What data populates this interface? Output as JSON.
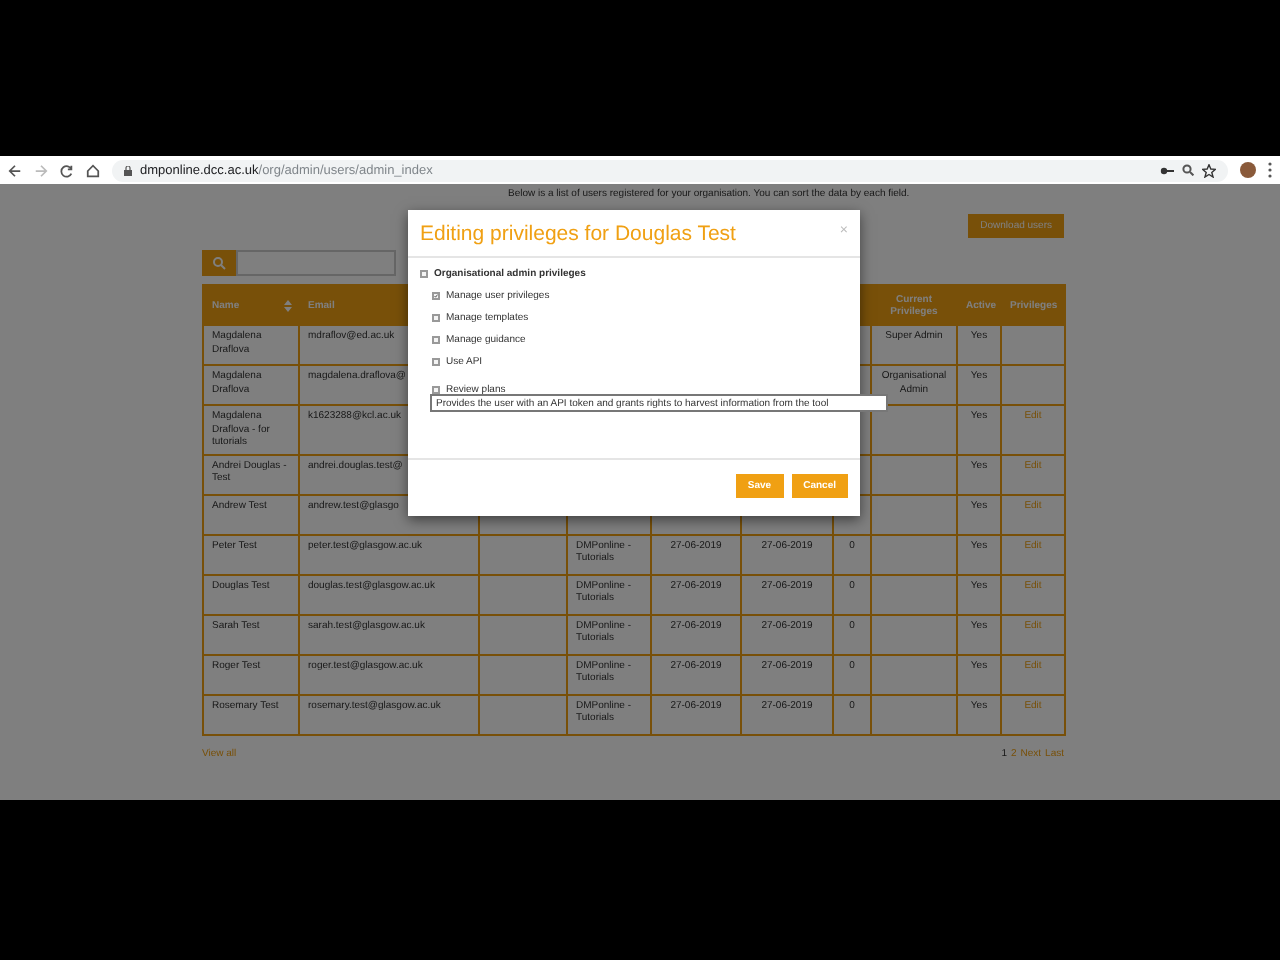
{
  "browser": {
    "url_host": "dmponline.dcc.ac.uk",
    "url_path": "/org/admin/users/admin_index"
  },
  "intro": "Below is a list of users registered for your organisation. You can sort the data by each field.",
  "download_button": "Download users",
  "table": {
    "columns": [
      "Name",
      "Email",
      null,
      null,
      null,
      null,
      null,
      "Current Privileges",
      "Active",
      "Privileges"
    ],
    "rows": [
      [
        "Magdalena Draflova",
        "mdraflov@ed.ac.uk",
        null,
        null,
        null,
        null,
        null,
        "Super Admin",
        "Yes",
        null
      ],
      [
        "Magdalena Draflova",
        "magdalena.draflova@",
        null,
        null,
        null,
        null,
        null,
        "Organisational Admin",
        "Yes",
        null
      ],
      [
        "Magdalena Draflova - for tutorials",
        "k1623288@kcl.ac.uk",
        null,
        null,
        null,
        null,
        null,
        null,
        "Yes",
        "Edit"
      ],
      [
        "Andrei Douglas - Test",
        "andrei.douglas.test@",
        null,
        null,
        null,
        null,
        null,
        null,
        "Yes",
        "Edit"
      ],
      [
        "Andrew Test",
        "andrew.test@glasgo",
        null,
        null,
        null,
        null,
        null,
        null,
        "Yes",
        "Edit"
      ],
      [
        "Peter Test",
        "peter.test@glasgow.ac.uk",
        null,
        "DMPonline - Tutorials",
        "27-06-2019",
        "27-06-2019",
        "0",
        null,
        "Yes",
        "Edit"
      ],
      [
        "Douglas Test",
        "douglas.test@glasgow.ac.uk",
        null,
        "DMPonline - Tutorials",
        "27-06-2019",
        "27-06-2019",
        "0",
        null,
        "Yes",
        "Edit"
      ],
      [
        "Sarah Test",
        "sarah.test@glasgow.ac.uk",
        null,
        "DMPonline - Tutorials",
        "27-06-2019",
        "27-06-2019",
        "0",
        null,
        "Yes",
        "Edit"
      ],
      [
        "Roger Test",
        "roger.test@glasgow.ac.uk",
        null,
        "DMPonline - Tutorials",
        "27-06-2019",
        "27-06-2019",
        "0",
        null,
        "Yes",
        "Edit"
      ],
      [
        "Rosemary Test",
        "rosemary.test@glasgow.ac.uk",
        null,
        "DMPonline - Tutorials",
        "27-06-2019",
        "27-06-2019",
        "0",
        null,
        "Yes",
        "Edit"
      ]
    ]
  },
  "view_all": "View all",
  "pagination": [
    {
      "label": "1",
      "selected": true
    },
    {
      "label": "2",
      "selected": false
    },
    {
      "label": "Next",
      "selected": false
    },
    {
      "label": "Last",
      "selected": false
    }
  ],
  "modal": {
    "title": "Editing privileges for Douglas Test",
    "close": "×",
    "privileges": [
      {
        "label": "Organisational admin privileges",
        "checked": false,
        "children": [
          {
            "label": "Manage user privileges",
            "checked": true
          },
          {
            "label": "Manage templates",
            "checked": false
          },
          {
            "label": "Manage guidance",
            "checked": false
          },
          {
            "label": "Use API",
            "checked": false
          },
          {
            "label": "Review plans",
            "checked": false
          }
        ]
      }
    ],
    "tooltip": "Provides the user with an API token and grants rights to harvest information from the tool",
    "buttons": [
      "Save",
      "Cancel"
    ]
  }
}
